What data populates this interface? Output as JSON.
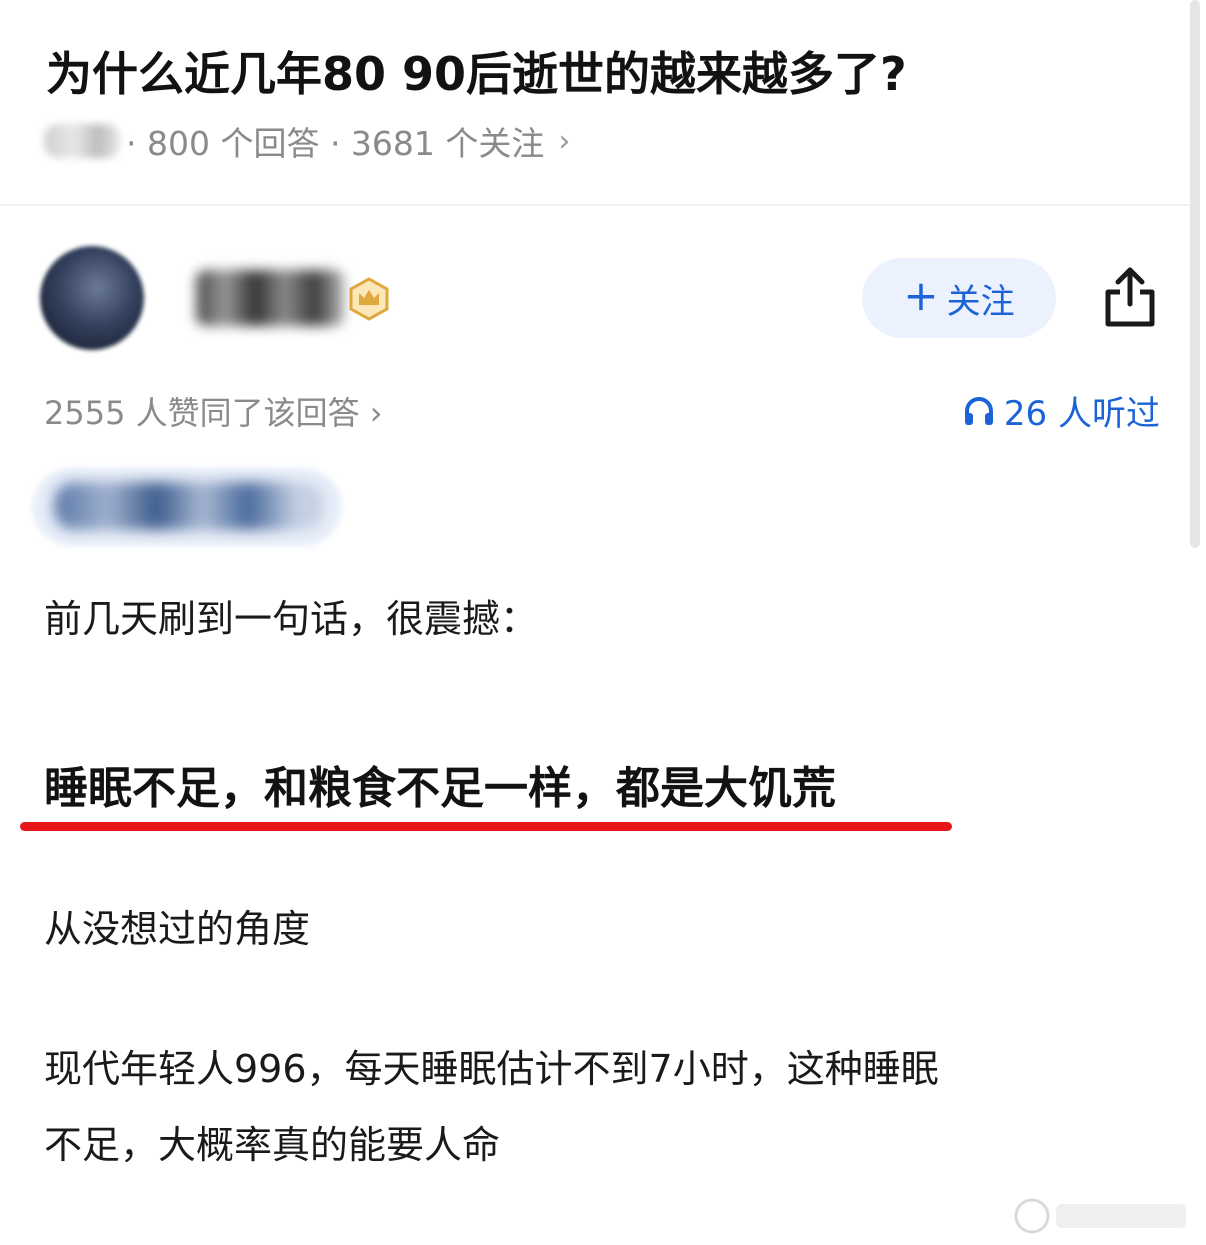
{
  "question": {
    "title": "为什么近几年80 90后逝世的越来越多了?",
    "meta": "· 800 个回答 · 3681 个关注",
    "chevron": "›"
  },
  "author": {
    "follow_plus": "+",
    "follow_label": "关注"
  },
  "stats": {
    "upvotes": "2555 人赞同了该回答 ›",
    "listened": "26 人听过"
  },
  "answer": {
    "paragraph_1": "前几天刷到一句话，很震撼：",
    "highlight": "睡眠不足，和粮食不足一样，都是大饥荒",
    "paragraph_2": "从没想过的角度",
    "paragraph_3_line_1": "现代年轻人996，每天睡眠估计不到7小时，这种睡眠",
    "paragraph_3_line_2": "不足，大概率真的能要人命"
  },
  "colors": {
    "accent_blue": "#1c63d8",
    "follow_bg": "#ebf2fd",
    "underline_red": "#e8161b",
    "badge_gold": "#e0a83c"
  },
  "icons": {
    "badge": "crown-badge-icon",
    "share": "share-icon",
    "listen": "headphone-icon"
  }
}
